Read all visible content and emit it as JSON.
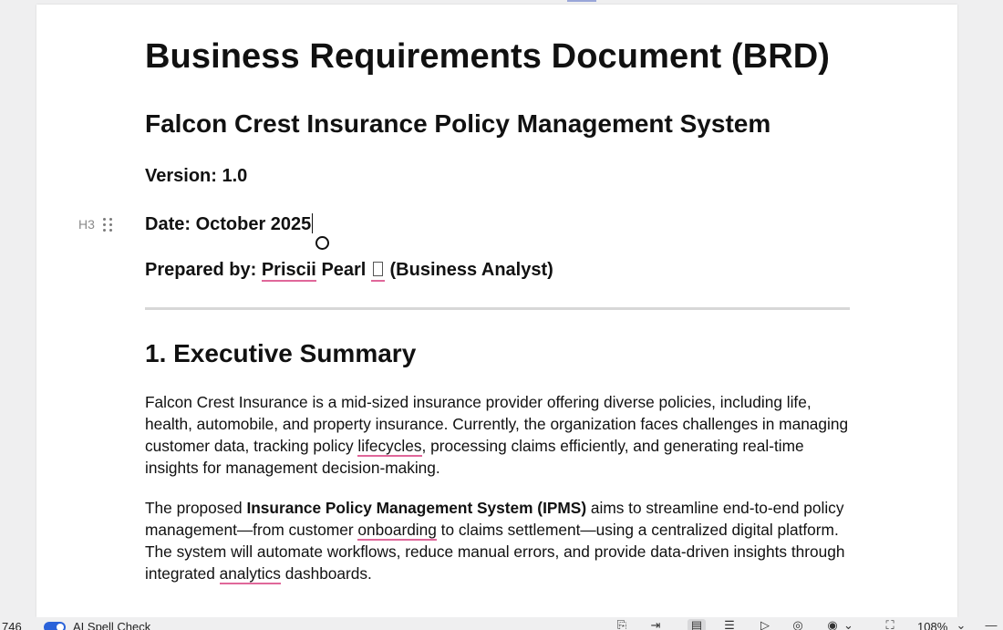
{
  "document": {
    "title": "Business Requirements Document (BRD)",
    "subtitle": "Falcon Crest Insurance Policy Management System",
    "version_line": "Version: 1.0",
    "date_line": "Date: October 2025",
    "prepared": {
      "label": "Prepared by:",
      "name_first": "Priscii",
      "name_last": "Pearl",
      "role": "(Business Analyst)"
    },
    "block_type_label": "H3",
    "section_heading": "1. Executive Summary",
    "paragraph1": "Falcon Crest Insurance is a mid-sized insurance provider offering diverse policies, including life, health, automobile, and property insurance. Currently, the organization faces challenges in managing customer data, tracking policy lifecycles, processing claims efficiently, and generating real-time insights for management decision-making.",
    "paragraph2": {
      "before": "The proposed ",
      "bold": "Insurance Policy Management System (IPMS)",
      "s1": " aims to streamline end-to-end policy management—from customer ",
      "w1": "onboarding",
      "s2": " to claims settlement—using a centralized digital platform. The system will automate workflows, reduce manual errors, and provide data-driven insights through integrated ",
      "w2": "analytics",
      "s3": " dashboards."
    }
  },
  "p1_parts": {
    "a": "Falcon Crest Insurance is a mid-sized insurance provider offering diverse policies, including life, health, automobile, and property insurance. Currently, the organization faces challenges in managing customer data, tracking policy ",
    "w": "lifecycles",
    "b": ", processing claims efficiently, and generating real-time insights for management decision-making."
  },
  "statusbar": {
    "word_count": "746",
    "spellcheck_label": "AI Spell Check",
    "zoom": "108%"
  }
}
